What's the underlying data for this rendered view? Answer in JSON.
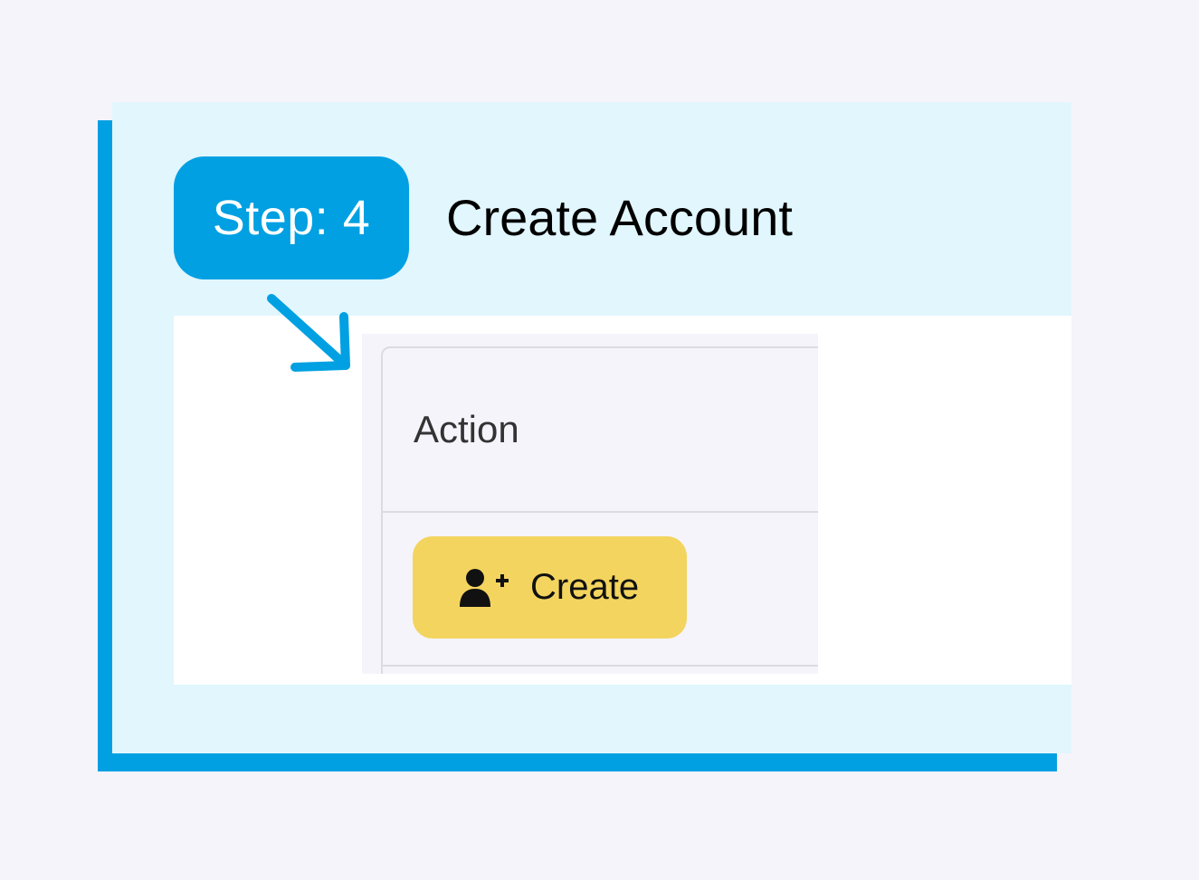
{
  "step": {
    "badge_label": "Step: 4",
    "title": "Create Account"
  },
  "screenshot": {
    "column_header": "Action",
    "create_button": {
      "label": "Create",
      "icon": "user-plus-icon"
    }
  },
  "colors": {
    "accent": "#00a0e2",
    "card_background": "#e1f6fd",
    "page_background": "#f5f4fa",
    "button_background": "#f3d45e"
  }
}
